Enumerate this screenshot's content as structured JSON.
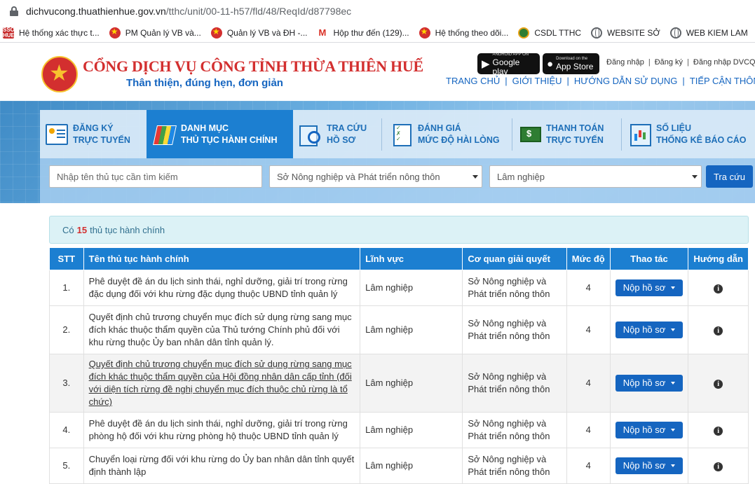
{
  "browser": {
    "url_host": "dichvucong.thuathienhue.gov.vn",
    "url_path": "/tthc/unit/00-11-h57/fld/48/ReqId/d87798ec",
    "bookmarks": [
      {
        "label": "Hệ thống xác thực t...",
        "icon": "sso-icon"
      },
      {
        "label": "PM Quản lý VB và...",
        "icon": "emblem-icon"
      },
      {
        "label": "Quản lý VB và ĐH -...",
        "icon": "emblem-icon"
      },
      {
        "label": "Hộp thư đến (129)...",
        "icon": "gmail-icon"
      },
      {
        "label": "Hệ thống theo dõi...",
        "icon": "emblem-icon"
      },
      {
        "label": "CSDL TTHC",
        "icon": "chrome-icon"
      },
      {
        "label": "WEBSITE SỞ",
        "icon": "globe-icon"
      },
      {
        "label": "WEB KIEM LAM",
        "icon": "globe-icon"
      }
    ]
  },
  "header": {
    "title": "CỔNG DỊCH VỤ CÔNG TỈNH THỪA THIÊN HUẾ",
    "slogan": "Thân thiện, đúng hẹn, đơn giản",
    "google_play_small": "ANDROID APP ON",
    "google_play": "Google play",
    "app_store_small": "Download on the",
    "app_store": "App Store",
    "login": "Đăng nhập",
    "register": "Đăng ký",
    "login_dvcq": "Đăng nhập DVCQ",
    "nav": [
      "TRANG CHỦ",
      "GIỚI THIỆU",
      "HƯỚNG DẪN SỬ DỤNG",
      "TIẾP CẬN THÔNG TIN"
    ]
  },
  "tabs": [
    {
      "line1": "ĐĂNG KÝ",
      "line2": "TRỰC TUYẾN"
    },
    {
      "line1": "DANH MỤC",
      "line2": "THỦ TỤC HÀNH CHÍNH"
    },
    {
      "line1": "TRA CỨU",
      "line2": "HỒ SƠ"
    },
    {
      "line1": "ĐÁNH GIÁ",
      "line2": "MỨC ĐỘ HÀI LÒNG"
    },
    {
      "line1": "THANH TOÁN",
      "line2": "TRỰC TUYẾN"
    },
    {
      "line1": "SỐ LIỆU",
      "line2": "THỐNG KÊ BÁO CÁO"
    }
  ],
  "search": {
    "placeholder": "Nhập tên thủ tục cần tìm kiếm",
    "agency": "Sở Nông nghiệp và Phát triển nông thôn",
    "field": "Lâm nghiệp",
    "button": "Tra cứu"
  },
  "count": {
    "prefix": "Có",
    "value": "15",
    "suffix": "thủ tục hành chính"
  },
  "table": {
    "headers": [
      "STT",
      "Tên thủ tục hành chính",
      "Lĩnh vực",
      "Cơ quan giải quyết",
      "Mức độ",
      "Thao tác",
      "Hướng dẫn"
    ],
    "action_label": "Nộp hồ sơ",
    "rows": [
      {
        "stt": "1.",
        "name": "Phê duyệt đề án du lịch sinh thái, nghỉ dưỡng, giải trí trong rừng đặc dụng đối với khu rừng đặc dụng thuộc UBND tỉnh quản lý",
        "field": "Lâm nghiệp",
        "agency": "Sở Nông nghiệp và Phát triển nông thôn",
        "level": "4"
      },
      {
        "stt": "2.",
        "name": "Quyết định chủ trương chuyển mục đích sử dụng rừng sang mục đích khác thuộc thẩm quyền của Thủ tướng Chính phủ đối với khu rừng thuộc Ủy ban nhân dân tỉnh quản lý.",
        "field": "Lâm nghiệp",
        "agency": "Sở Nông nghiệp và Phát triển nông thôn",
        "level": "4"
      },
      {
        "stt": "3.",
        "name": "Quyết định chủ trương chuyển mục đích sử dụng rừng sang mục đích khác thuộc thẩm quyền của Hội đồng nhân dân cấp tỉnh (đối với diện tích rừng đề nghị chuyển mục đích thuộc chủ rừng là tổ chức)",
        "field": "Lâm nghiệp",
        "agency": "Sở Nông nghiệp và Phát triển nông thôn",
        "level": "4"
      },
      {
        "stt": "4.",
        "name": "Phê duyệt đề án du lịch sinh thái, nghỉ dưỡng, giải trí trong rừng phòng hộ đối với khu rừng phòng hộ thuộc UBND tỉnh quản lý",
        "field": "Lâm nghiệp",
        "agency": "Sở Nông nghiệp và Phát triển nông thôn",
        "level": "4"
      },
      {
        "stt": "5.",
        "name": "Chuyển loại rừng đối với khu rừng do Ủy ban nhân dân tỉnh quyết định thành lập",
        "field": "Lâm nghiệp",
        "agency": "Sở Nông nghiệp và Phát triển nông thôn",
        "level": "4"
      }
    ]
  }
}
